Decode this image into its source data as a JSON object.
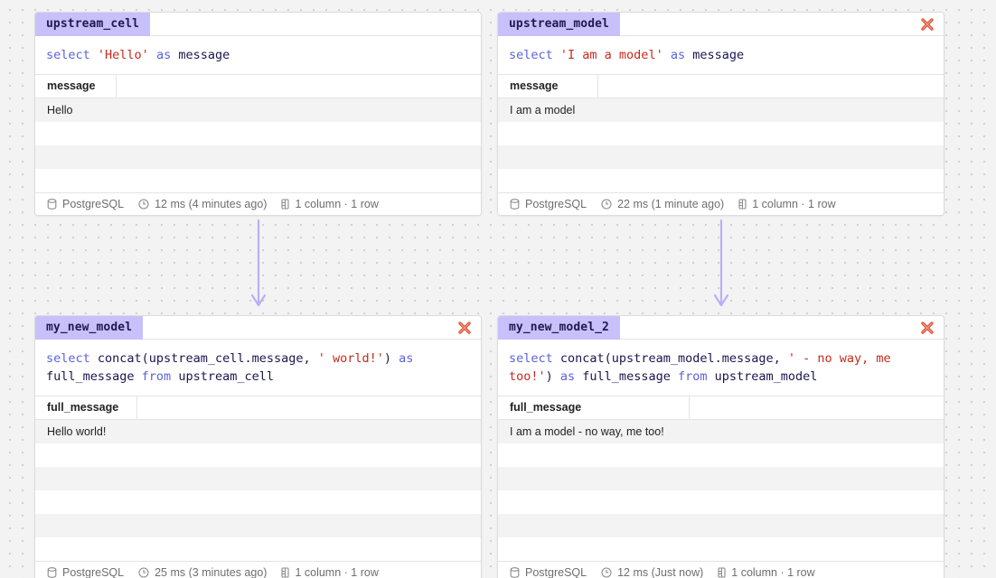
{
  "colors": {
    "accent": "#c7c0fb",
    "keyword": "#5a63d8",
    "string": "#c8291b",
    "close": "#e0533a",
    "arrow": "#b9b0f5"
  },
  "cells": [
    {
      "name": "upstream_cell",
      "closable": false,
      "code_tokens": [
        {
          "t": "kw",
          "v": "select "
        },
        {
          "t": "str",
          "v": "'Hello'"
        },
        {
          "t": "kw",
          "v": " as "
        },
        {
          "t": "id",
          "v": "message"
        }
      ],
      "columns": [
        "message"
      ],
      "rows": [
        [
          "Hello"
        ]
      ],
      "footer": {
        "db": "PostgreSQL",
        "timing": "12 ms (4 minutes ago)",
        "shape": "1 column · 1 row"
      }
    },
    {
      "name": "upstream_model",
      "closable": true,
      "code_tokens": [
        {
          "t": "kw",
          "v": "select "
        },
        {
          "t": "str",
          "v": "'I am a model'"
        },
        {
          "t": "kw",
          "v": " as "
        },
        {
          "t": "id",
          "v": "message"
        }
      ],
      "columns": [
        "message"
      ],
      "rows": [
        [
          "I am a model"
        ]
      ],
      "footer": {
        "db": "PostgreSQL",
        "timing": "22 ms (1 minute ago)",
        "shape": "1 column · 1 row"
      }
    },
    {
      "name": "my_new_model",
      "closable": true,
      "code_tokens": [
        {
          "t": "kw",
          "v": "select "
        },
        {
          "t": "id",
          "v": "concat(upstream_cell.message, "
        },
        {
          "t": "str",
          "v": "' world!'"
        },
        {
          "t": "id",
          "v": ") "
        },
        {
          "t": "kw",
          "v": "as"
        },
        {
          "t": "br",
          "v": ""
        },
        {
          "t": "id",
          "v": "full_message "
        },
        {
          "t": "kw",
          "v": "from "
        },
        {
          "t": "id",
          "v": "upstream_cell"
        }
      ],
      "columns": [
        "full_message"
      ],
      "rows": [
        [
          "Hello world!"
        ]
      ],
      "footer": {
        "db": "PostgreSQL",
        "timing": "25 ms (3 minutes ago)",
        "shape": "1 column · 1 row"
      }
    },
    {
      "name": "my_new_model_2",
      "closable": true,
      "code_tokens": [
        {
          "t": "kw",
          "v": "select "
        },
        {
          "t": "id",
          "v": "concat(upstream_model.message, "
        },
        {
          "t": "str",
          "v": "' - no way, me"
        },
        {
          "t": "br",
          "v": ""
        },
        {
          "t": "str",
          "v": "too!'"
        },
        {
          "t": "id",
          "v": ") "
        },
        {
          "t": "kw",
          "v": "as "
        },
        {
          "t": "id",
          "v": "full_message "
        },
        {
          "t": "kw",
          "v": "from "
        },
        {
          "t": "id",
          "v": "upstream_model"
        }
      ],
      "columns": [
        "full_message"
      ],
      "rows": [
        [
          "I am a model - no way, me too!"
        ]
      ],
      "footer": {
        "db": "PostgreSQL",
        "timing": "12 ms (Just now)",
        "shape": "1 column · 1 row"
      }
    }
  ]
}
